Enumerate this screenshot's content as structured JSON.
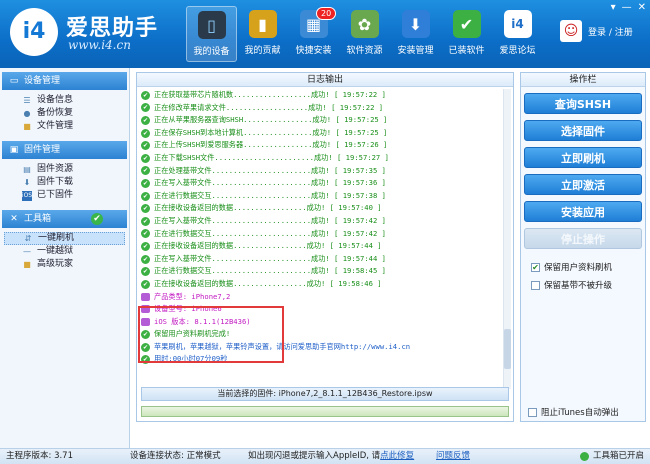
{
  "app": {
    "logo_mark": "i4",
    "logo_text": "爱思助手",
    "url": "www.i4.cn"
  },
  "nav": [
    {
      "label": "我的设备",
      "icon": "phone-icon",
      "color": "#2a3a4a",
      "active": true
    },
    {
      "label": "我的贡献",
      "icon": "chart-icon",
      "color": "#d7a21b"
    },
    {
      "label": "快捷安装",
      "icon": "apps-icon",
      "color": "#3a8ad6",
      "badge": "20"
    },
    {
      "label": "软件资源",
      "icon": "bag-icon",
      "color": "#6aa84f"
    },
    {
      "label": "安装管理",
      "icon": "download-icon",
      "color": "#2f7fd8"
    },
    {
      "label": "已装软件",
      "icon": "check-icon",
      "color": "#3cb043"
    },
    {
      "label": "爱思论坛",
      "icon": "forum-icon",
      "color": "#1f6fc8"
    }
  ],
  "user": {
    "login": "登录 / 注册"
  },
  "sidebar": {
    "sections": [
      {
        "title": "设备管理",
        "items": [
          "设备信息",
          "备份恢复",
          "文件管理"
        ]
      },
      {
        "title": "固件管理",
        "items": [
          "固件资源",
          "固件下载",
          "已下固件"
        ]
      },
      {
        "title": "工具箱",
        "items": [
          "一键刷机",
          "一键越狱",
          "高级玩家"
        ]
      }
    ]
  },
  "log": {
    "title": "日志输出",
    "lines": [
      {
        "msg": "正在获取基带芯片随机数..................成功! [ 19:57:22 ]"
      },
      {
        "msg": "正在修改苹果请求文件...................成功! [ 19:57:22 ]"
      },
      {
        "msg": "正在从苹果服务器查询SHSH................成功! [ 19:57:25 ]"
      },
      {
        "msg": "正在保存SHSH到本地计算机................成功! [ 19:57:25 ]"
      },
      {
        "msg": "正在上传SHSH到爱思服务器................成功! [ 19:57:26 ]"
      },
      {
        "msg": "正在下载SHSH文件.......................成功! [ 19:57:27 ]"
      },
      {
        "msg": "正在处理基带文件.......................成功! [ 19:57:35 ]"
      },
      {
        "msg": "正在写入基带文件.......................成功! [ 19:57:36 ]"
      },
      {
        "msg": "正在进行数据交互.......................成功! [ 19:57:38 ]"
      },
      {
        "msg": "正在接收设备返回的数据.................成功! [ 19:57:40 ]"
      },
      {
        "msg": "正在写入基带文件.......................成功! [ 19:57:42 ]"
      },
      {
        "msg": "正在进行数据交互.......................成功! [ 19:57:42 ]"
      },
      {
        "msg": "正在接收设备返回的数据.................成功! [ 19:57:44 ]"
      },
      {
        "msg": "正在写入基带文件.......................成功! [ 19:57:44 ]"
      },
      {
        "msg": "正在进行数据交互.......................成功! [ 19:58:45 ]"
      },
      {
        "msg": "正在接收设备返回的数据.................成功! [ 19:58:46 ]"
      }
    ],
    "info_lines": [
      {
        "msg": "产品类型: iPhone7,2"
      },
      {
        "msg": "设备型号: iPhone6"
      },
      {
        "msg": "iOS 版本: 8.1.1(12B436)"
      }
    ],
    "done_line": "保留用户资料刷机完成!",
    "tip_line": "苹果刷机，苹果越狱，苹果铃声设置，请访问爱思助手官网http://www.i4.cn",
    "time_line": "用时:00小时07分09秒",
    "firmware": "当前选择的固件: iPhone7,2_8.1.1_12B436_Restore.ipsw"
  },
  "ops": {
    "title": "操作栏",
    "buttons": [
      {
        "label": "查询SHSH",
        "enabled": true
      },
      {
        "label": "选择固件",
        "enabled": true
      },
      {
        "label": "立即刷机",
        "enabled": true
      },
      {
        "label": "立即激活",
        "enabled": true
      },
      {
        "label": "安装应用",
        "enabled": true
      },
      {
        "label": "停止操作",
        "enabled": false
      }
    ],
    "options": [
      {
        "label": "保留用户资料刷机",
        "checked": true
      },
      {
        "label": "保留基带不被升级",
        "checked": false
      }
    ],
    "itunes_option": "阻止iTunes自动弹出"
  },
  "status": {
    "version": "主程序版本: 3.71",
    "device_state": "设备连接状态: 正常模式",
    "appleid_prefix": "如出现闪退或提示输入AppleID, 请",
    "appleid_link": "点此修复",
    "feedback": "问题反馈",
    "toolbox": "工具箱已开启"
  }
}
